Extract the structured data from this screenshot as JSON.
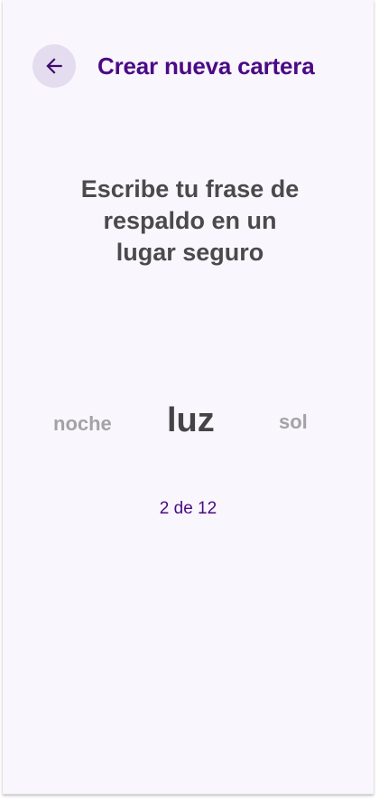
{
  "header": {
    "title": "Crear nueva cartera",
    "back_icon": "arrow-left-icon"
  },
  "instruction": {
    "line1": "Escribe tu frase de",
    "line2": "respaldo en un",
    "line3": "lugar seguro"
  },
  "words": {
    "previous": "noche",
    "current": "luz",
    "next": "sol"
  },
  "progress": {
    "text": "2 de 12",
    "current": 2,
    "total": 12
  },
  "colors": {
    "accent": "#4b0a86",
    "background": "#f9f6fd",
    "back_button_bg": "#e4dcef",
    "text_dark": "#4a4a4c",
    "text_muted": "#a3a3a6"
  }
}
